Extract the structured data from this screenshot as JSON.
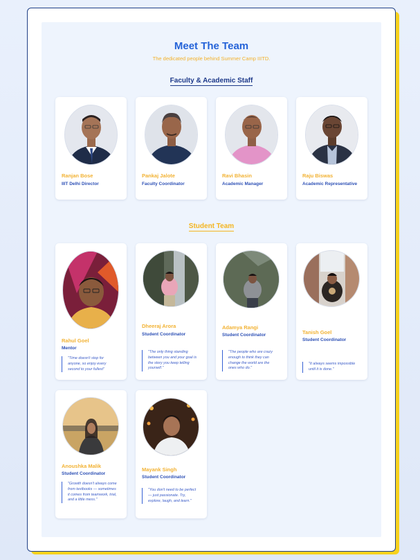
{
  "header": {
    "title": "Meet The Team",
    "subtitle": "The dedicated people behind Summer Camp IIITD."
  },
  "faculty_section": {
    "title": "Faculty & Academic Staff",
    "members": [
      {
        "name": "Ranjan Bose",
        "role": "IIIT Delhi Director"
      },
      {
        "name": "Pankaj Jalote",
        "role": "Faculty Coordinator"
      },
      {
        "name": "Ravi Bhasin",
        "role": "Academic Manager"
      },
      {
        "name": "Raju Biswas",
        "role": "Academic Representative"
      }
    ]
  },
  "student_section": {
    "title": "Student Team",
    "members": [
      {
        "name": "Rahul Goel",
        "role": "Mentor",
        "quote": "\"Time doesn't stop for anyone, so enjoy every second to your fullest\""
      },
      {
        "name": "Dheeraj Arora",
        "role": "Student Coordinator",
        "quote": "\"The only thing standing between you and your goal is the story you keep telling yourself.\""
      },
      {
        "name": "Adamya Rangi",
        "role": "Student Coordinator",
        "quote": "\"The people who are crazy enough to think they can change the world are the ones who do.\""
      },
      {
        "name": "Tanish Goel",
        "role": "Student Coordinator",
        "quote": "\"It always seems impossible until it is done.\""
      },
      {
        "name": "Anoushka Malik",
        "role": "Student Coordinator",
        "quote": "\"Growth doesn't always come from textbooks — sometimes it comes from teamwork, trial, and a little mess.\""
      },
      {
        "name": "Mayank Singh",
        "role": "Student Coordinator",
        "quote": "\"You don't need to be perfect — just passionate. Try, explore, laugh, and learn.\""
      }
    ]
  }
}
